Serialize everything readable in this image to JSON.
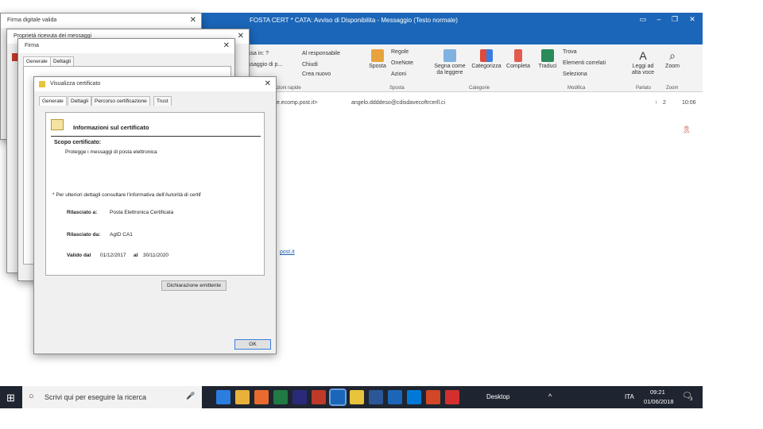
{
  "outlook": {
    "title": "FOSTA CERT * CATA: Avviso di Disponibilita  -  Messaggio (Testo normale)",
    "ribbon": {
      "quick": [
        "ssa in: ?",
        "ssaggio di p...",
        "Crea nuovo"
      ],
      "quick2": [
        "Al responsabile",
        "Chiudi"
      ],
      "group_quick": "Azioni rapide",
      "move": "Sposta",
      "rules": "Regole",
      "onenote": "OneNote",
      "actions": "Azioni",
      "group_move": "Sposta",
      "unread": "Segna come da leggere",
      "categorize": "Categorizza",
      "followup": "Completa",
      "group_tags": "Categorie",
      "translate": "Traduci",
      "find": "Trova",
      "related": "Elementi correlati",
      "select": "Seleziona",
      "group_edit": "Modifica",
      "read_aloud": "Leggi ad alta voce",
      "group_speech": "Parlato",
      "zoom": "Zoom",
      "group_zoom": "Zoom"
    },
    "from_partial": "te.ecomp.post.it>",
    "to": "angelo.ddddeso@cdisdavecoftrcerll.ci",
    "importance": "2",
    "time": "10:06",
    "link_partial": "post.it"
  },
  "dlg_back": {
    "title": "Firma digitale valida",
    "sub": "Proprietà ricevuta dei messaggi"
  },
  "dlg_mid": {
    "title": "Firma",
    "tabs": [
      "Generale",
      "Dettagli"
    ]
  },
  "cert": {
    "title": "Visualizza certificato",
    "tabs": [
      "Generale",
      "Dettagli",
      "Percorso certificazione",
      "Trust"
    ],
    "heading": "Informazioni sul certificato",
    "purpose_label": "Scopo certificato:",
    "purpose": "Protegge i messaggi di posta elettronica",
    "note": "* Per ulteriori dettagli consultare l'informativa dell'Autorità di certif",
    "issued_to_label": "Rilasciato a:",
    "issued_to": "Posta Elettronica Certificata",
    "issued_by_label": "Rilasciato da:",
    "issued_by": "AgID CA1",
    "valid_label": "Valido dal",
    "valid_from": "01/12/2017",
    "valid_to_label": "al",
    "valid_to": "30/11/2020",
    "issuer_btn": "Dichiarazione emittente",
    "ok": "OK"
  },
  "taskbar": {
    "search": "Scrivi qui per eseguire la ricerca",
    "desktop": "Desktop",
    "lang": "ITA",
    "time": "09:21",
    "date": "01/06/2018",
    "notif": "3"
  },
  "colors": {
    "accent": "#1b66b8",
    "taskbar": "#1f2530"
  }
}
